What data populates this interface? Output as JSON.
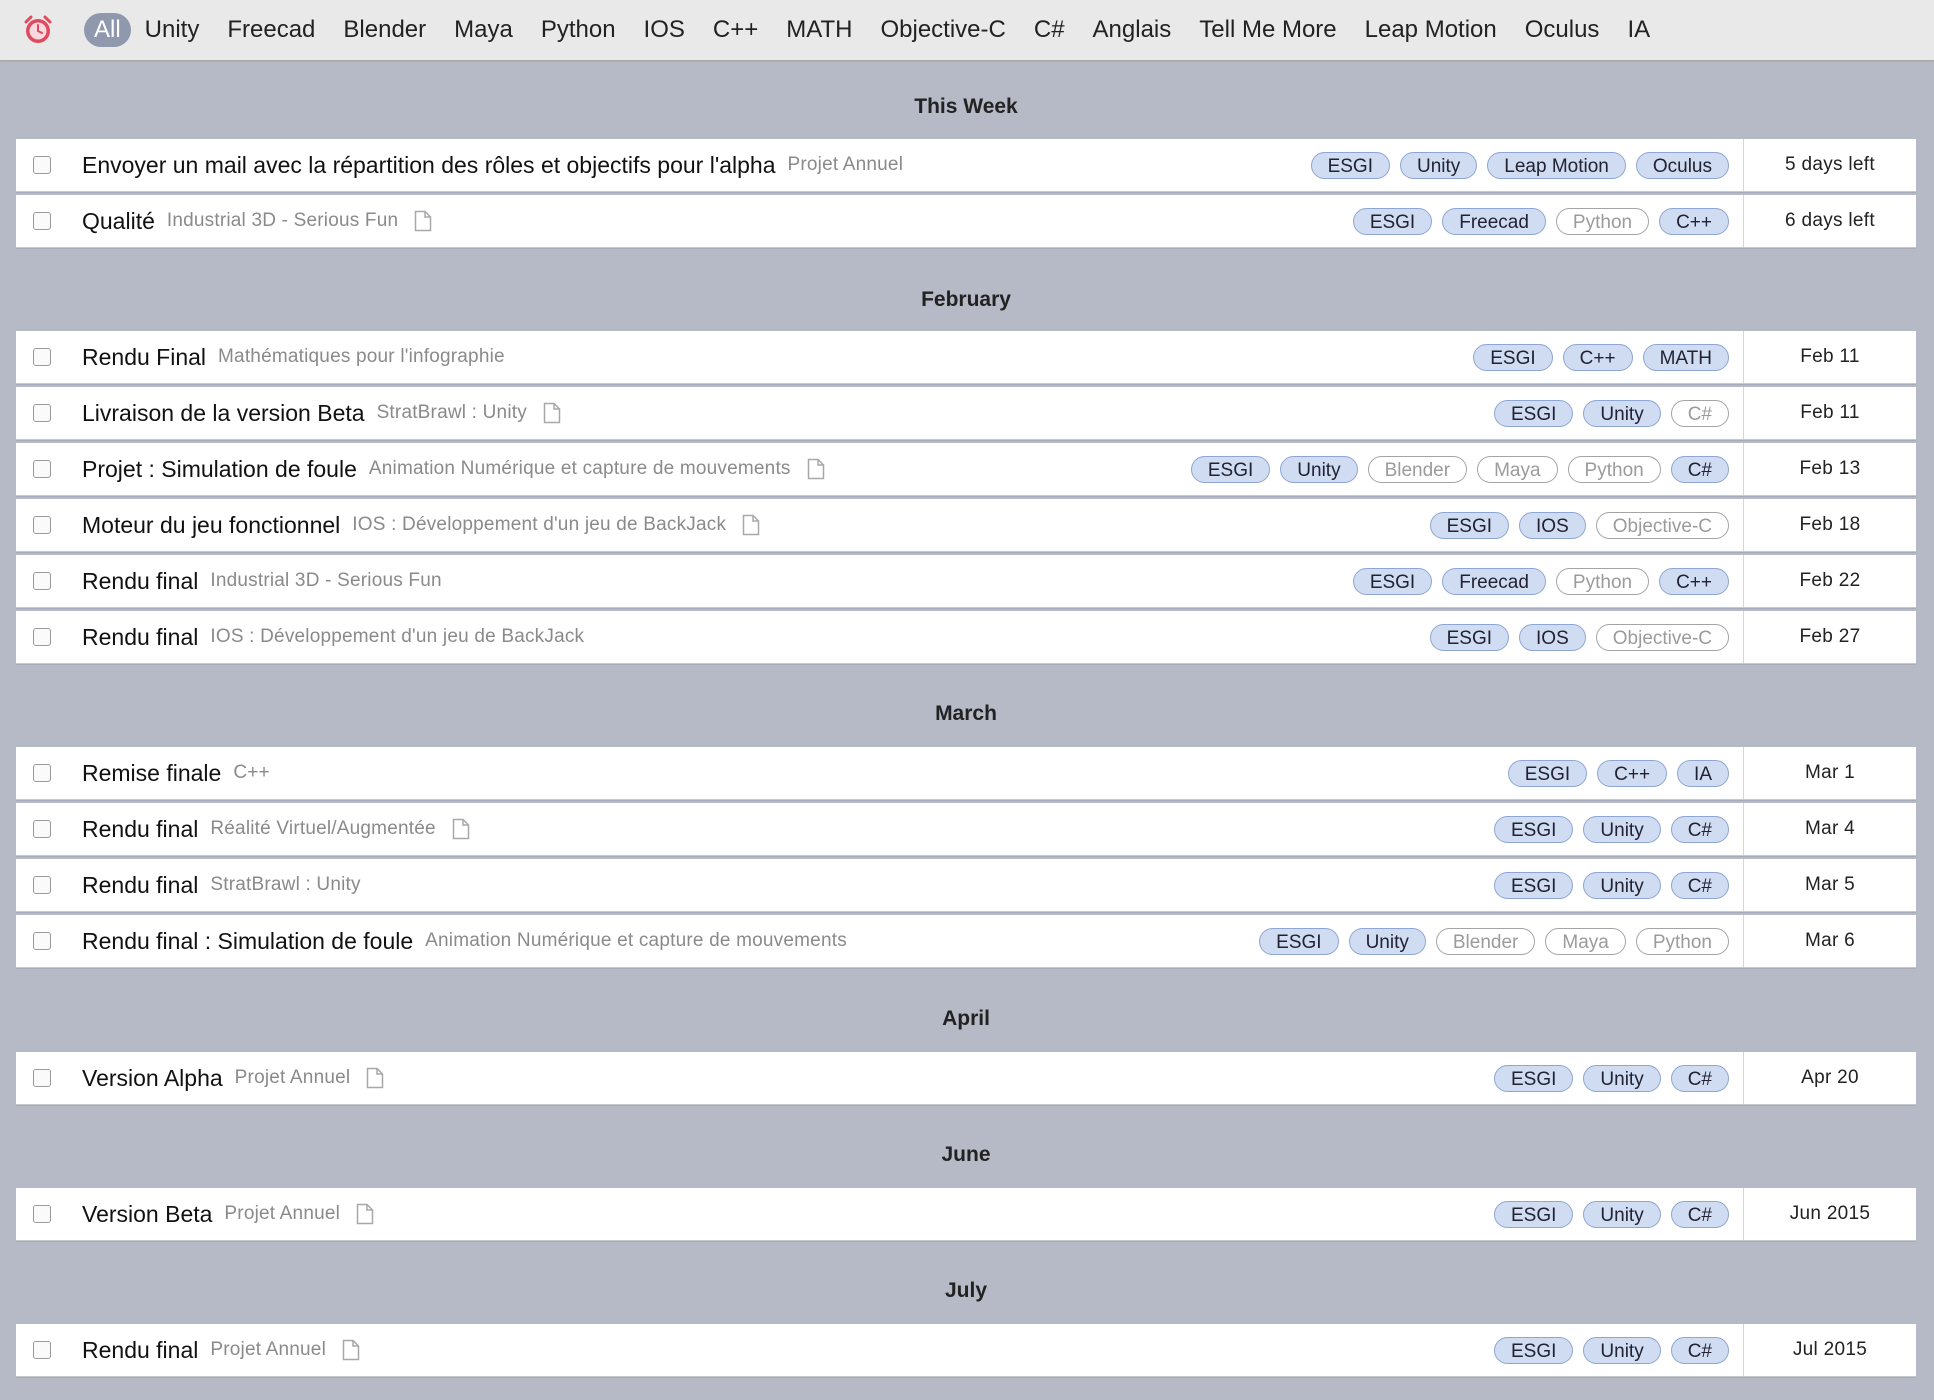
{
  "filters": [
    "All",
    "Unity",
    "Freecad",
    "Blender",
    "Maya",
    "Python",
    "IOS",
    "C++",
    "MATH",
    "Objective-C",
    "C#",
    "Anglais",
    "Tell Me More",
    "Leap Motion",
    "Oculus",
    "IA"
  ],
  "active_filter": "All",
  "colors": {
    "accent": "#e04a5f",
    "tag_on_bg": "#d0dcf2",
    "tag_on_border": "#8ea6d1",
    "active_filter_bg": "#8f98ad",
    "background": "#b6bac7"
  },
  "sections": [
    {
      "title": "This Week",
      "tasks": [
        {
          "title": "Envoyer un mail avec la répartition des rôles et objectifs pour l'alpha",
          "project": "Projet Annuel",
          "note": false,
          "tags": [
            {
              "label": "ESGI",
              "on": true
            },
            {
              "label": "Unity",
              "on": true
            },
            {
              "label": "Leap Motion",
              "on": true
            },
            {
              "label": "Oculus",
              "on": true
            }
          ],
          "due": "5 days left"
        },
        {
          "title": "Qualité",
          "project": "Industrial 3D - Serious Fun",
          "note": true,
          "tags": [
            {
              "label": "ESGI",
              "on": true
            },
            {
              "label": "Freecad",
              "on": true
            },
            {
              "label": "Python",
              "on": false
            },
            {
              "label": "C++",
              "on": true
            }
          ],
          "due": "6 days left"
        }
      ]
    },
    {
      "title": "February",
      "tasks": [
        {
          "title": "Rendu Final",
          "project": "Mathématiques pour l'infographie",
          "note": false,
          "tags": [
            {
              "label": "ESGI",
              "on": true
            },
            {
              "label": "C++",
              "on": true
            },
            {
              "label": "MATH",
              "on": true
            }
          ],
          "due": "Feb 11"
        },
        {
          "title": "Livraison de la version Beta",
          "project": "StratBrawl : Unity",
          "note": true,
          "tags": [
            {
              "label": "ESGI",
              "on": true
            },
            {
              "label": "Unity",
              "on": true
            },
            {
              "label": "C#",
              "on": false
            }
          ],
          "due": "Feb 11"
        },
        {
          "title": "Projet : Simulation de foule",
          "project": "Animation Numérique et capture de mouvements",
          "note": true,
          "tags": [
            {
              "label": "ESGI",
              "on": true
            },
            {
              "label": "Unity",
              "on": true
            },
            {
              "label": "Blender",
              "on": false
            },
            {
              "label": "Maya",
              "on": false
            },
            {
              "label": "Python",
              "on": false
            },
            {
              "label": "C#",
              "on": true
            }
          ],
          "due": "Feb 13"
        },
        {
          "title": "Moteur du jeu fonctionnel",
          "project": "IOS : Développement d'un jeu de BackJack",
          "note": true,
          "tags": [
            {
              "label": "ESGI",
              "on": true
            },
            {
              "label": "IOS",
              "on": true
            },
            {
              "label": "Objective-C",
              "on": false
            }
          ],
          "due": "Feb 18"
        },
        {
          "title": "Rendu final",
          "project": "Industrial 3D - Serious Fun",
          "note": false,
          "tags": [
            {
              "label": "ESGI",
              "on": true
            },
            {
              "label": "Freecad",
              "on": true
            },
            {
              "label": "Python",
              "on": false
            },
            {
              "label": "C++",
              "on": true
            }
          ],
          "due": "Feb 22"
        },
        {
          "title": "Rendu final",
          "project": "IOS : Développement d'un jeu de BackJack",
          "note": false,
          "tags": [
            {
              "label": "ESGI",
              "on": true
            },
            {
              "label": "IOS",
              "on": true
            },
            {
              "label": "Objective-C",
              "on": false
            }
          ],
          "due": "Feb 27"
        }
      ]
    },
    {
      "title": "March",
      "tasks": [
        {
          "title": "Remise finale",
          "project": "C++",
          "note": false,
          "tags": [
            {
              "label": "ESGI",
              "on": true
            },
            {
              "label": "C++",
              "on": true
            },
            {
              "label": "IA",
              "on": true
            }
          ],
          "due": "Mar 1"
        },
        {
          "title": "Rendu final",
          "project": "Réalité Virtuel/Augmentée",
          "note": true,
          "tags": [
            {
              "label": "ESGI",
              "on": true
            },
            {
              "label": "Unity",
              "on": true
            },
            {
              "label": "C#",
              "on": true
            }
          ],
          "due": "Mar 4"
        },
        {
          "title": "Rendu final",
          "project": "StratBrawl : Unity",
          "note": false,
          "tags": [
            {
              "label": "ESGI",
              "on": true
            },
            {
              "label": "Unity",
              "on": true
            },
            {
              "label": "C#",
              "on": true
            }
          ],
          "due": "Mar 5"
        },
        {
          "title": "Rendu final : Simulation de foule",
          "project": "Animation Numérique et capture de mouvements",
          "note": false,
          "tags": [
            {
              "label": "ESGI",
              "on": true
            },
            {
              "label": "Unity",
              "on": true
            },
            {
              "label": "Blender",
              "on": false
            },
            {
              "label": "Maya",
              "on": false
            },
            {
              "label": "Python",
              "on": false
            }
          ],
          "due": "Mar 6"
        }
      ]
    },
    {
      "title": "April",
      "tasks": [
        {
          "title": "Version Alpha",
          "project": "Projet Annuel",
          "note": true,
          "tags": [
            {
              "label": "ESGI",
              "on": true
            },
            {
              "label": "Unity",
              "on": true
            },
            {
              "label": "C#",
              "on": true
            }
          ],
          "due": "Apr 20"
        }
      ]
    },
    {
      "title": "June",
      "tasks": [
        {
          "title": "Version Beta",
          "project": "Projet Annuel",
          "note": true,
          "tags": [
            {
              "label": "ESGI",
              "on": true
            },
            {
              "label": "Unity",
              "on": true
            },
            {
              "label": "C#",
              "on": true
            }
          ],
          "due": "Jun 2015"
        }
      ]
    },
    {
      "title": "July",
      "tasks": [
        {
          "title": "Rendu final",
          "project": "Projet Annuel",
          "note": true,
          "tags": [
            {
              "label": "ESGI",
              "on": true
            },
            {
              "label": "Unity",
              "on": true
            },
            {
              "label": "C#",
              "on": true
            }
          ],
          "due": "Jul 2015"
        }
      ]
    }
  ]
}
